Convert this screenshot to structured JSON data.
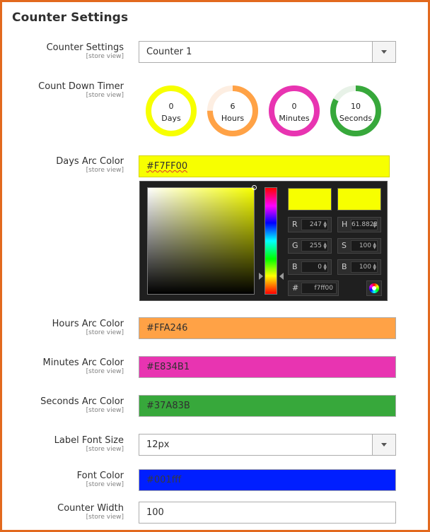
{
  "page": {
    "title": "Counter Settings"
  },
  "scope_label": "[store view]",
  "fields": {
    "counter_settings": {
      "label": "Counter Settings",
      "value": "Counter 1"
    },
    "count_down_timer": {
      "label": "Count Down Timer"
    },
    "days_arc_color": {
      "label": "Days Arc Color",
      "value": "#F7FF00",
      "color": "#f7ff00"
    },
    "hours_arc_color": {
      "label": "Hours Arc Color",
      "value": "#FFA246",
      "color": "#ffa246"
    },
    "minutes_arc_color": {
      "label": "Minutes Arc Color",
      "value": "#E834B1",
      "color": "#e834b1"
    },
    "seconds_arc_color": {
      "label": "Seconds Arc Color",
      "value": "#37A83B",
      "color": "#37a83b"
    },
    "label_font_size": {
      "label": "Label Font Size",
      "value": "12px"
    },
    "font_color": {
      "label": "Font Color",
      "value": "#001fff",
      "color": "#001fff"
    },
    "counter_width": {
      "label": "Counter Width",
      "value": "100"
    }
  },
  "timer": [
    {
      "value": "0",
      "label": "Days",
      "color": "#f7ff00",
      "progress": 1.0
    },
    {
      "value": "6",
      "label": "Hours",
      "color": "#ffa246",
      "progress": 0.75
    },
    {
      "value": "0",
      "label": "Minutes",
      "color": "#e834b1",
      "progress": 1.0
    },
    {
      "value": "10",
      "label": "Seconds",
      "color": "#37a83b",
      "progress": 0.83
    }
  ],
  "picker": {
    "new_color": "#f7ff00",
    "current_color": "#f7ff00",
    "channels": {
      "r": {
        "letter": "R",
        "value": "247"
      },
      "g": {
        "letter": "G",
        "value": "255"
      },
      "b": {
        "letter": "B",
        "value": "0"
      },
      "h": {
        "letter": "H",
        "value": "61.8823"
      },
      "s": {
        "letter": "S",
        "value": "100"
      },
      "br": {
        "letter": "B",
        "value": "100"
      }
    },
    "hex": {
      "letter": "#",
      "value": "f7ff00"
    },
    "hue_level": 0.83
  },
  "colors": {
    "frame_border": "#e2691e"
  }
}
